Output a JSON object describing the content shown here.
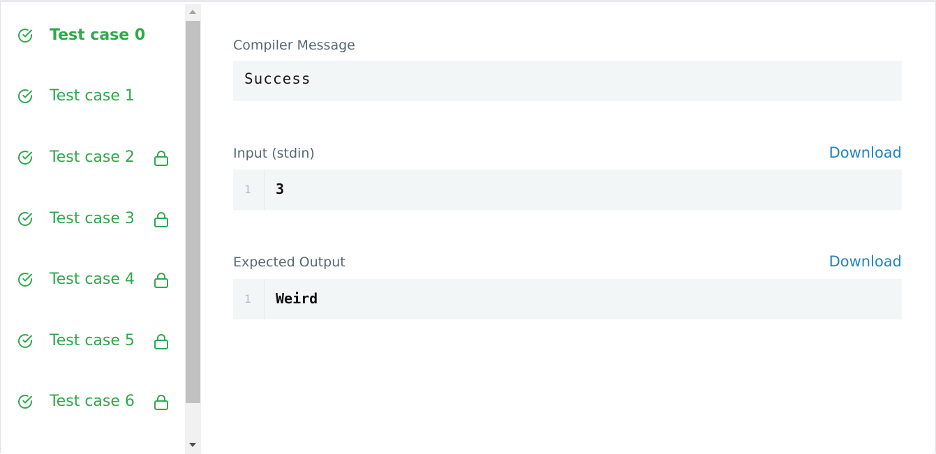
{
  "test_cases": [
    {
      "label": "Test case 0",
      "active": true,
      "locked": false
    },
    {
      "label": "Test case 1",
      "active": false,
      "locked": false
    },
    {
      "label": "Test case 2",
      "active": false,
      "locked": true
    },
    {
      "label": "Test case 3",
      "active": false,
      "locked": true
    },
    {
      "label": "Test case 4",
      "active": false,
      "locked": true
    },
    {
      "label": "Test case 5",
      "active": false,
      "locked": true
    },
    {
      "label": "Test case 6",
      "active": false,
      "locked": true
    }
  ],
  "icons": {
    "status": "check-circle-icon",
    "lock": "lock-icon"
  },
  "colors": {
    "pass_green": "#2ea94b",
    "link_blue": "#1f83c5",
    "label_gray": "#576871",
    "box_bg": "#f3f6f7"
  },
  "compiler": {
    "label": "Compiler Message",
    "message": "Success"
  },
  "input": {
    "label": "Input (stdin)",
    "download_label": "Download",
    "lines": [
      {
        "number": "1",
        "text": "3"
      }
    ]
  },
  "expected_output": {
    "label": "Expected Output",
    "download_label": "Download",
    "lines": [
      {
        "number": "1",
        "text": "Weird"
      }
    ]
  }
}
